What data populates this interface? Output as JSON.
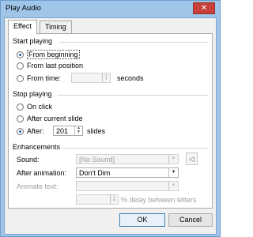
{
  "window": {
    "title": "Play Audio",
    "close_glyph": "✕"
  },
  "tabs": [
    {
      "label": "Effect"
    },
    {
      "label": "Timing"
    }
  ],
  "start_playing": {
    "title": "Start playing",
    "from_beginning": "From beginning",
    "from_last_position": "From last position",
    "from_time": "From time:",
    "time_unit": "seconds",
    "selected": "from_beginning"
  },
  "stop_playing": {
    "title": "Stop playing",
    "on_click": "On click",
    "after_current_slide": "After current slide",
    "after": "After:",
    "after_value": "201",
    "slides_unit": "slides",
    "selected": "after"
  },
  "enhancements": {
    "title": "Enhancements",
    "sound_label": "Sound:",
    "sound_value": "[No Sound]",
    "after_animation_label": "After animation:",
    "after_animation_value": "Don't Dim",
    "animate_text_label": "Animate text:",
    "delay_label": "% delay between letters",
    "speaker_icon": "speaker-icon"
  },
  "buttons": {
    "ok": "OK",
    "cancel": "Cancel"
  }
}
